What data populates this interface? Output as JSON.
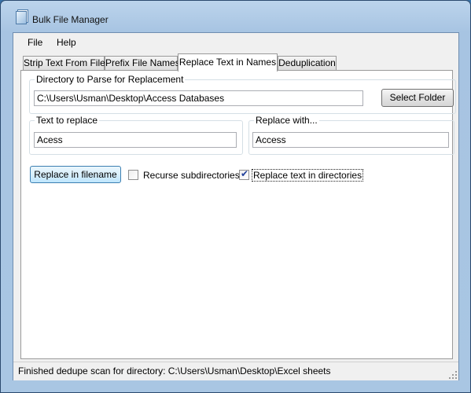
{
  "window": {
    "title": "Bulk File Manager",
    "icon": "app-window-icon"
  },
  "menu": {
    "items": [
      "File",
      "Help"
    ]
  },
  "tabs": [
    {
      "label": "Strip Text From Files",
      "active": false
    },
    {
      "label": "Prefix File Names",
      "active": false
    },
    {
      "label": "Replace Text in Names",
      "active": true
    },
    {
      "label": "Deduplication",
      "active": false
    }
  ],
  "directory": {
    "group_label": "Directory to Parse for Replacement",
    "value": "C:\\Users\\Usman\\Desktop\\Access Databases",
    "button_label": "Select Folder"
  },
  "text_to_replace": {
    "group_label": "Text to replace",
    "value": "Acess"
  },
  "replace_with": {
    "group_label": "Replace with...",
    "value": "Access"
  },
  "actions": {
    "replace_button_label": "Replace in filename"
  },
  "options": {
    "recurse": {
      "label": "Recurse subdirectories",
      "checked": false
    },
    "replace_dirs": {
      "label": "Replace text in directories",
      "checked": true
    }
  },
  "status": {
    "text": "Finished dedupe scan for directory: C:\\Users\\Usman\\Desktop\\Excel sheets"
  },
  "colors": {
    "frame": "#a9c6e3",
    "accent": "#3c7fb1",
    "check": "#21409a"
  }
}
